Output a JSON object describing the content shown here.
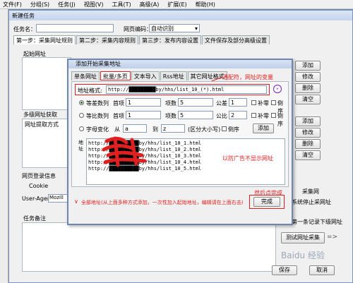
{
  "menu": [
    "文件(F)",
    "分组(S)",
    "任务(J)",
    "视图(V)",
    "工具(T)",
    "高级(A)",
    "扩展(E)",
    "帮助(H)"
  ],
  "main": {
    "title": "新建任务",
    "task_name_label": "任务名：",
    "encoding_label": "网页编码：",
    "encoding_value": "自动识别",
    "tabs": [
      "第一步：采集网址规则",
      "第二步：采集内容规则",
      "第三步：发布内容设置",
      "文件保存及部分高级设置"
    ],
    "start_url_label": "起始网址",
    "multi_level_label": "多级网址获取",
    "url_extract_col": "网址提取方式",
    "login_label": "网页登录信息",
    "cookie_label": "Cookie",
    "useragent_label": "User-Agent",
    "useragent_value": "Mozill",
    "notes_label": "任务备注",
    "right_buttons": [
      "添加",
      "修改",
      "删除",
      "清空"
    ],
    "right_buttons2": [
      "添加",
      "修改",
      "删除",
      "清空"
    ],
    "right_text1": "采集网",
    "right_text2": "后系统停止采网址",
    "right_text3": "不第一条记录下级网址",
    "test_button": "测试网址采集",
    "save_button": "保存",
    "cancel_button": "取消",
    "watermark": "Baidu 经验"
  },
  "dialog": {
    "title": "添加开始采集地址",
    "tabs": [
      "单条网址",
      "批量/多页",
      "文本导入",
      "Rss地址",
      "其它网址格式"
    ],
    "annotation_top": "通配符，网址的变量",
    "format_label": "地址格式:",
    "format_value": "http://█████████by/hhs/list_10_(*).html",
    "row1": {
      "label": "等差数列",
      "first": "首项",
      "first_val": "1",
      "count": "项数",
      "count_val": "5",
      "diff": "公差",
      "diff_val": "1",
      "pad": "补零",
      "reverse": "倒序"
    },
    "row2": {
      "label": "等比数列",
      "first": "首项",
      "first_val": "1",
      "count": "项数",
      "count_val": "5",
      "ratio": "公比",
      "ratio_val": "2",
      "pad": "补零",
      "reverse": "倒序"
    },
    "row3": {
      "label": "字母变化",
      "from": "从",
      "from_val": "a",
      "to": "到",
      "to_val": "z",
      "case_note": "(区分大小写)",
      "reverse": "倒序"
    },
    "add_button": "添加",
    "list_label": "地址",
    "urls": [
      "http://██████████by/hhs/list_10_1.html",
      "http://██████████by/hhs/list_10_2.html",
      "http://██████████by/hhs/list_10_3.html",
      "http://██████████by/hhs/list_10_4.html",
      "http://██████████by/hhs/list_10_5.html"
    ],
    "ad_note": "以防广告不显示网址",
    "then_click": "然后点完成",
    "bottom_text": "全部地址(从上面多种方式添加，一次性加入起始地址，编辑请在上面右击)",
    "finish_button": "完成"
  },
  "colors": {
    "annotation": "#e02020",
    "titlebar": "#c3d4ec",
    "desktop": "#6b86a8"
  }
}
